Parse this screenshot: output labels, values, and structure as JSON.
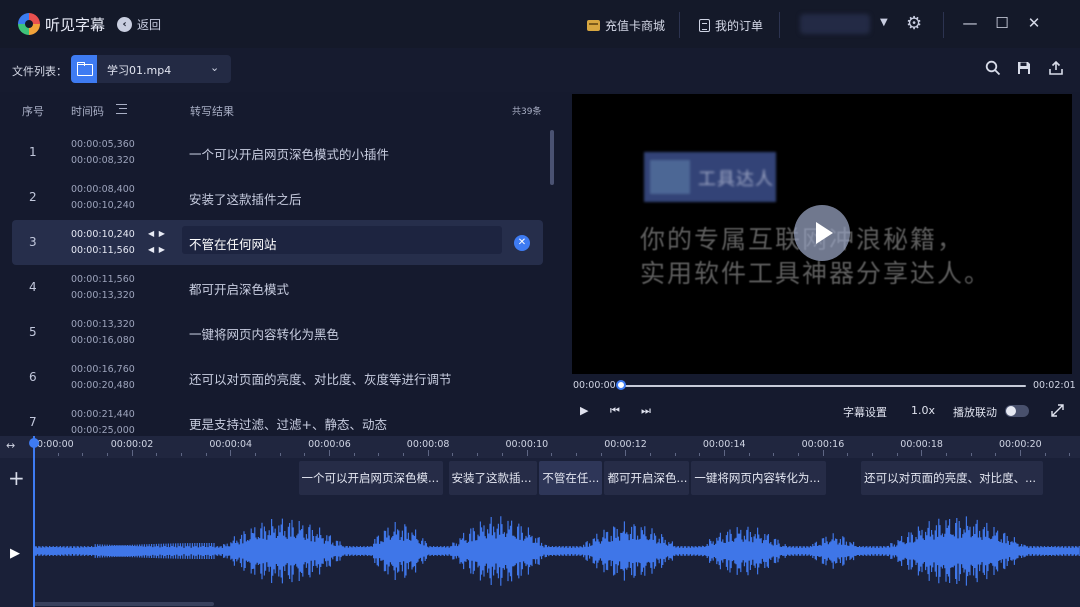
{
  "titlebar": {
    "app_title": "听见字幕",
    "back_label": "返回",
    "recharge_label": "充值卡商城",
    "orders_label": "我的订单"
  },
  "toolbar": {
    "file_list_label": "文件列表：",
    "file_name": "学习01.mp4"
  },
  "list": {
    "col_index": "序号",
    "col_timecode": "时间码",
    "col_result": "转写结果",
    "count": "共39条",
    "rows": [
      {
        "index": "1",
        "start": "00:00:05,360",
        "end": "00:00:08,320",
        "text": "一个可以开启网页深色模式的小插件"
      },
      {
        "index": "2",
        "start": "00:00:08,400",
        "end": "00:00:10,240",
        "text": "安装了这款插件之后"
      },
      {
        "index": "3",
        "start": "00:00:10,240",
        "end": "00:00:11,560",
        "text": "不管在任何网站"
      },
      {
        "index": "4",
        "start": "00:00:11,560",
        "end": "00:00:13,320",
        "text": "都可开启深色模式"
      },
      {
        "index": "5",
        "start": "00:00:13,320",
        "end": "00:00:16,080",
        "text": "一键将网页内容转化为黑色"
      },
      {
        "index": "6",
        "start": "00:00:16,760",
        "end": "00:00:20,480",
        "text": "还可以对页面的亮度、对比度、灰度等进行调节"
      },
      {
        "index": "7",
        "start": "00:00:21,440",
        "end": "00:00:25,000",
        "text": "更是支持过滤、过滤+、静态、动态"
      }
    ],
    "active_index": 3
  },
  "video": {
    "watermark_text": "工具达人",
    "subtitle_line1": "你的专属互联网冲浪秘籍，",
    "subtitle_line2": "实用软件工具神器分享达人。",
    "current_time": "00:00:00",
    "total_time": "00:02:01",
    "progress": 0.0,
    "subtitle_settings_label": "字幕设置",
    "speed": "1.0x",
    "linked_play_label": "播放联动",
    "linked_play_on": false
  },
  "timeline": {
    "ticks": [
      "00:00:00",
      "00:00:02",
      "00:00:04",
      "00:00:06",
      "00:00:08",
      "00:00:10",
      "00:00:12",
      "00:00:14",
      "00:00:16",
      "00:00:18",
      "00:00:20"
    ],
    "seconds_visible": 21,
    "clips": [
      {
        "start": 5.36,
        "end": 8.32,
        "text": "一个可以开启网页深色模...",
        "active": false
      },
      {
        "start": 8.4,
        "end": 10.24,
        "text": "安装了这款插...",
        "active": false
      },
      {
        "start": 10.24,
        "end": 11.56,
        "text": "不管在任...",
        "active": true
      },
      {
        "start": 11.56,
        "end": 13.32,
        "text": "都可开启深色...",
        "active": false
      },
      {
        "start": 13.32,
        "end": 16.08,
        "text": "一键将网页内容转化为...",
        "active": false
      },
      {
        "start": 16.76,
        "end": 20.48,
        "text": "还可以对页面的亮度、对比度、...",
        "active": false
      }
    ]
  },
  "icons": {
    "search": "search-icon",
    "save": "save-icon",
    "share": "export-icon",
    "settings": "gear-icon",
    "minimize": "minimize-icon",
    "maximize": "maximize-icon",
    "close": "close-icon"
  },
  "colors": {
    "accent": "#3e7bf2",
    "waveform": "#3f76e8",
    "background": "#151a2e"
  }
}
